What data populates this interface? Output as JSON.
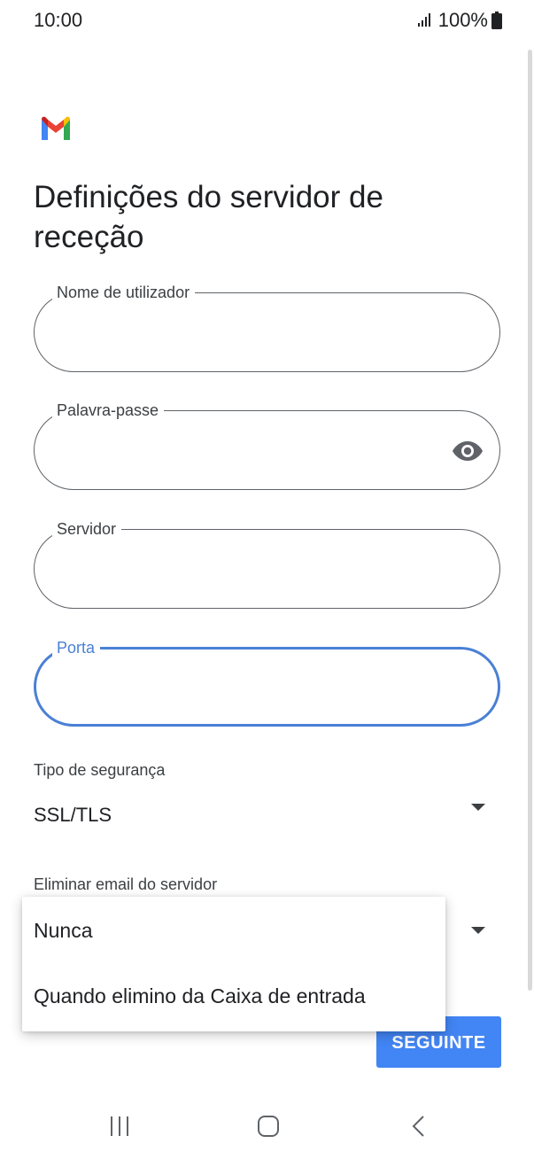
{
  "status_bar": {
    "time": "10:00",
    "battery": "100%",
    "icons": [
      "signal-icon",
      "battery-icon"
    ]
  },
  "app": {
    "logo": "gmail-logo-icon",
    "title": "Definições do servidor de receção"
  },
  "form": {
    "username": {
      "label": "Nome de utilizador",
      "value": ""
    },
    "password": {
      "label": "Palavra-passe",
      "value": "",
      "icon": "eye-icon"
    },
    "server": {
      "label": "Servidor",
      "value": ""
    },
    "port": {
      "label": "Porta",
      "value": ""
    }
  },
  "security": {
    "label": "Tipo de segurança",
    "value": "SSL/TLS"
  },
  "delete_email": {
    "label": "Eliminar email do servidor",
    "options": [
      "Nunca",
      "Quando elimino da Caixa de entrada"
    ]
  },
  "next_button": "SEGUINTE",
  "colors": {
    "accent": "#4285f4",
    "focus": "#4a80d6"
  },
  "nav": [
    "recents-icon",
    "home-icon",
    "back-icon"
  ]
}
